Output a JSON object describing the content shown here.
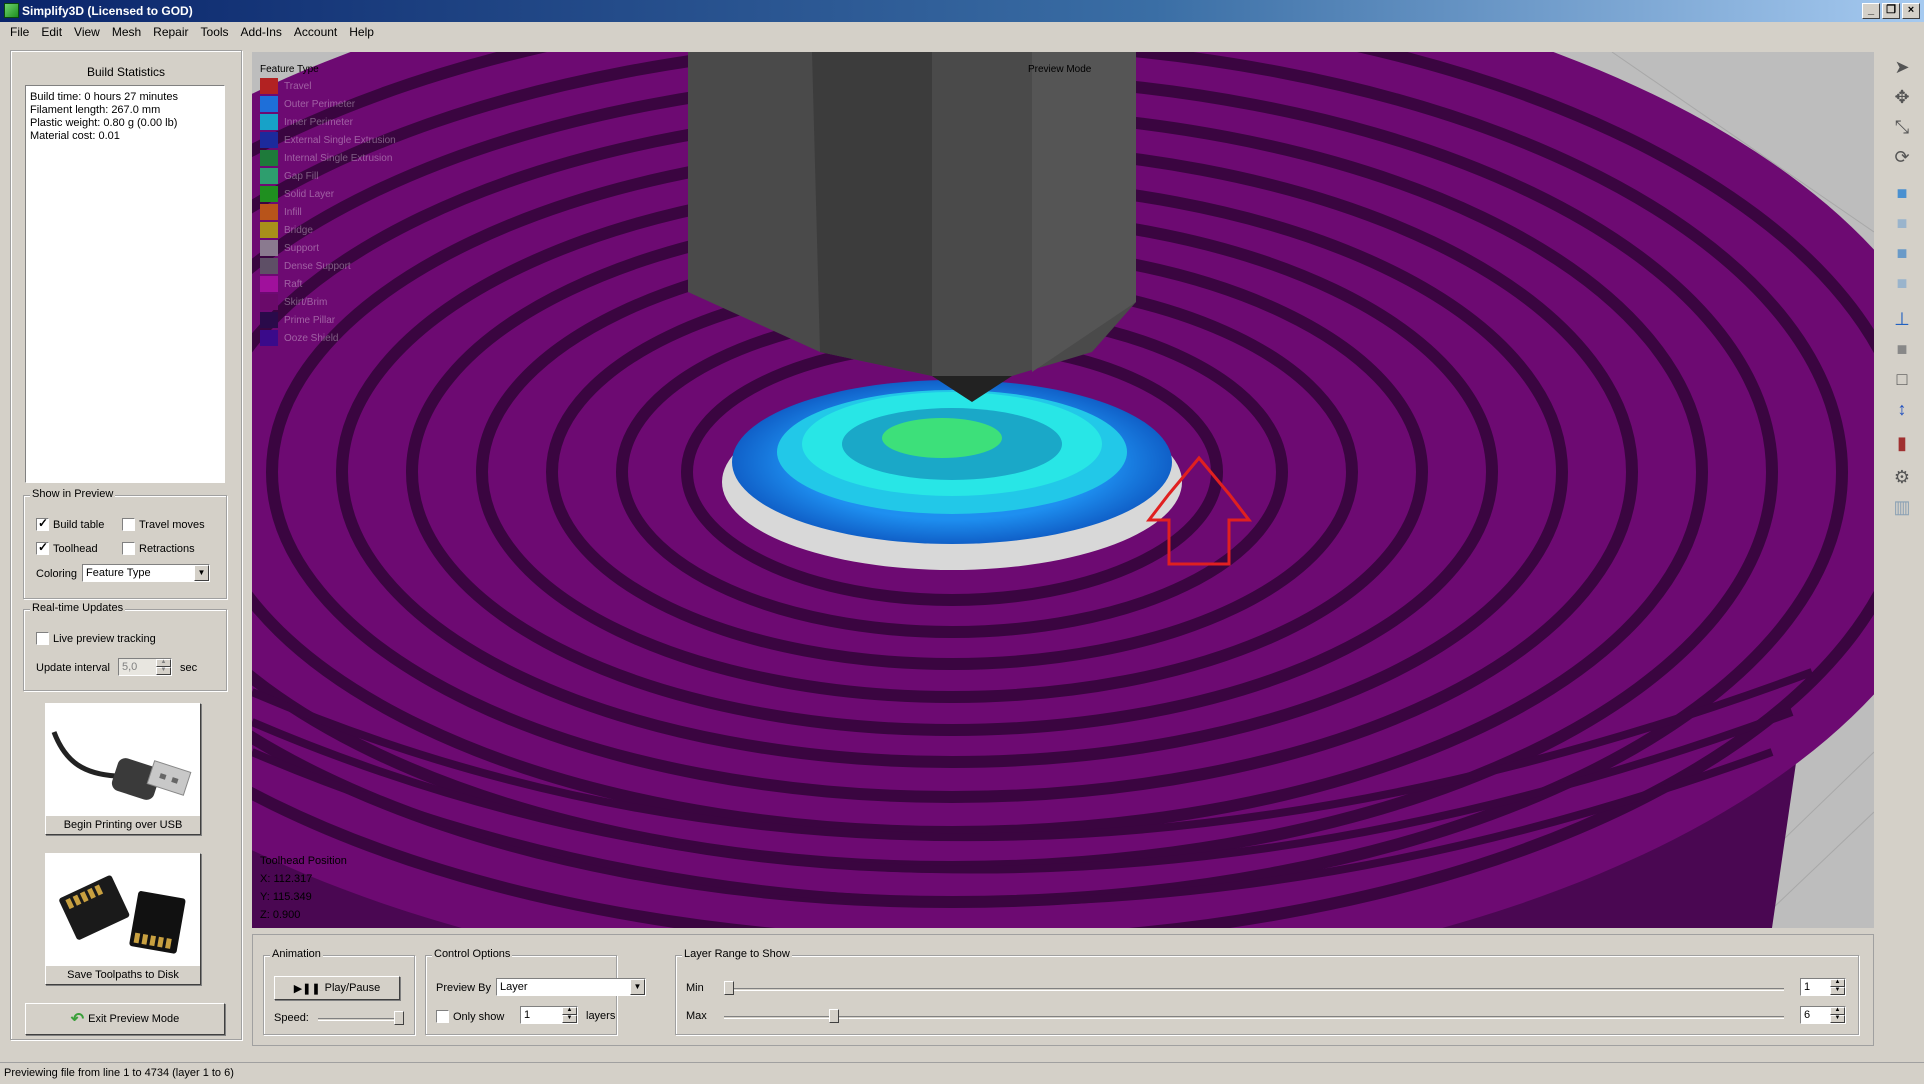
{
  "window": {
    "title": "Simplify3D (Licensed to GOD)",
    "buttons": [
      "_",
      "❐",
      "×"
    ]
  },
  "menu": [
    "File",
    "Edit",
    "View",
    "Mesh",
    "Repair",
    "Tools",
    "Add-Ins",
    "Account",
    "Help"
  ],
  "build_statistics": {
    "title": "Build Statistics",
    "lines": [
      "Build time: 0 hours 27 minutes",
      "Filament length: 267.0 mm",
      "Plastic weight: 0.80 g (0.00 lb)",
      "Material cost: 0.01"
    ]
  },
  "show_in_preview": {
    "legend": "Show in Preview",
    "build_table": {
      "label": "Build table",
      "checked": true
    },
    "travel_moves": {
      "label": "Travel moves",
      "checked": false
    },
    "toolhead": {
      "label": "Toolhead",
      "checked": true
    },
    "retractions": {
      "label": "Retractions",
      "checked": false
    },
    "coloring_label": "Coloring",
    "coloring_value": "Feature Type"
  },
  "realtime_updates": {
    "legend": "Real-time Updates",
    "live_tracking": {
      "label": "Live preview tracking",
      "checked": false
    },
    "interval_label": "Update interval",
    "interval_value": "5,0",
    "interval_unit": "sec"
  },
  "buttons": {
    "usb": "Begin Printing over USB",
    "sd": "Save Toolpaths to Disk",
    "exit": "Exit Preview Mode"
  },
  "viewport": {
    "legend_title": "Feature Type",
    "legend": [
      {
        "label": "Travel",
        "color": "#b22222"
      },
      {
        "label": "Outer Perimeter",
        "color": "#1e6fd9"
      },
      {
        "label": "Inner Perimeter",
        "color": "#17a2c8"
      },
      {
        "label": "External Single Extrusion",
        "color": "#1c2a9c"
      },
      {
        "label": "Internal Single Extrusion",
        "color": "#1e7a3a"
      },
      {
        "label": "Gap Fill",
        "color": "#2e9e6e"
      },
      {
        "label": "Solid Layer",
        "color": "#1f8f1f"
      },
      {
        "label": "Infill",
        "color": "#b8541a"
      },
      {
        "label": "Bridge",
        "color": "#a8901a"
      },
      {
        "label": "Support",
        "color": "#8a7a8f"
      },
      {
        "label": "Dense Support",
        "color": "#5e4f66"
      },
      {
        "label": "Raft",
        "color": "#a0109c"
      },
      {
        "label": "Skirt/Brim",
        "color": "#6a0a6a"
      },
      {
        "label": "Prime Pillar",
        "color": "#2a0a4a"
      },
      {
        "label": "Ooze Shield",
        "color": "#3a0a8a"
      }
    ],
    "mode_label": "Preview Mode",
    "toolhead_title": "Toolhead Position",
    "x": "X: 112.317",
    "y": "Y: 115.349",
    "z": "Z: 0.900"
  },
  "animation": {
    "legend": "Animation",
    "play_label": "Play/Pause",
    "speed_label": "Speed:"
  },
  "control_options": {
    "legend": "Control Options",
    "preview_by_label": "Preview By",
    "preview_by_value": "Layer",
    "only_show_label": "Only show",
    "only_show_value": "1",
    "layers_label": "layers"
  },
  "layer_range": {
    "legend": "Layer Range to Show",
    "min_label": "Min",
    "max_label": "Max",
    "min_value": "1",
    "max_value": "6",
    "min_fraction": 0.0,
    "max_fraction": 0.1
  },
  "status": "Previewing file from line 1 to 4734 (layer 1 to 6)",
  "colors": {
    "raft": "#6d0a72",
    "raft_dark": "#3a0540",
    "outer": "#1e8ff0",
    "inner": "#22e8e8",
    "solid": "#3de07a",
    "nozzle": "#4a4a4a",
    "arrow": "#e02020"
  },
  "toolbar_icons": [
    "select-arrow-icon",
    "move-icon",
    "scale-icon",
    "rotate-icon",
    "cube-front-icon",
    "cube-top-icon",
    "cube-side-icon",
    "cube-iso-icon",
    "axes-icon",
    "cube-shaded-icon",
    "cube-wire-icon",
    "z-axis-icon",
    "section-icon",
    "gear-icon",
    "supports-icon"
  ]
}
